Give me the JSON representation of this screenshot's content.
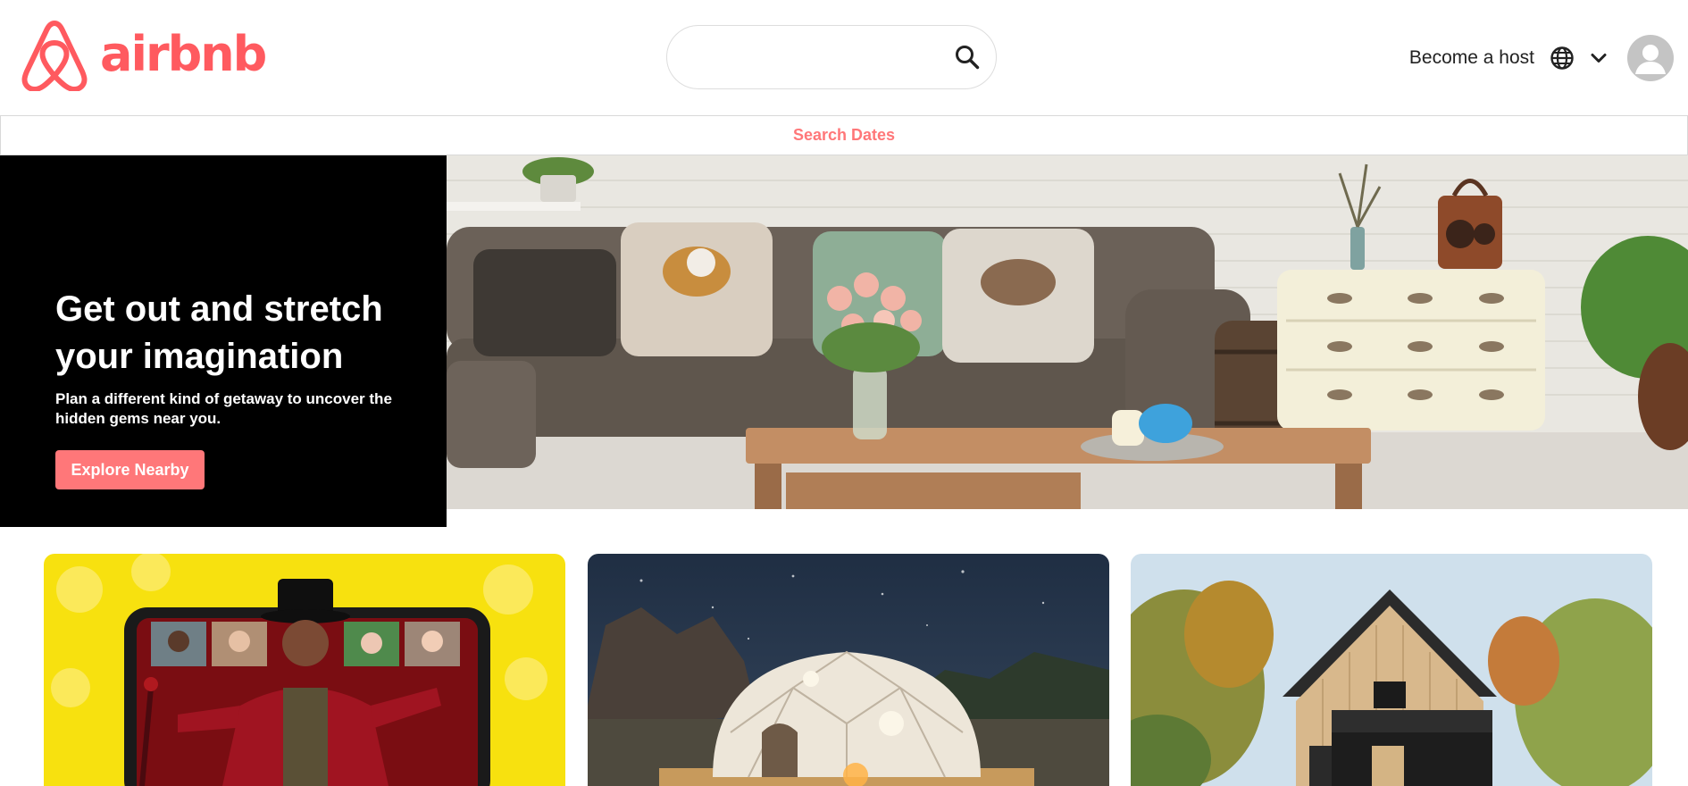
{
  "header": {
    "brand_name": "airbnb",
    "search": {
      "placeholder": ""
    },
    "become_host_label": "Become a host"
  },
  "dates_bar": {
    "label": "Search Dates"
  },
  "hero": {
    "title": "Get out and stretch your imagination",
    "subtitle": "Plan a different kind of getaway to uncover the hidden gems near you.",
    "cta_label": "Explore Nearby",
    "image": "living-room-sofa-photo"
  },
  "cards": [
    {
      "image": "online-experiences-showman-photo"
    },
    {
      "image": "geodesic-dome-night-photo"
    },
    {
      "image": "wooden-cabin-forest-photo"
    }
  ],
  "colors": {
    "brand": "#ff5a5f",
    "accent": "#ff7779",
    "hero_panel": "#000000"
  }
}
